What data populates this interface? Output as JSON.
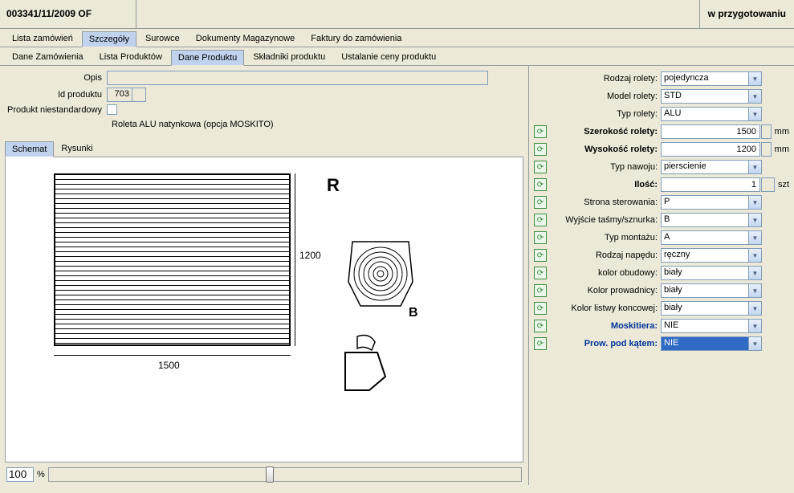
{
  "header": {
    "order_number": "003341/11/2009 OF",
    "status": "w przygotowaniu"
  },
  "tabs": {
    "items": [
      {
        "label": "Lista zamówień"
      },
      {
        "label": "Szczegóły"
      },
      {
        "label": "Surowce"
      },
      {
        "label": "Dokumenty Magazynowe"
      },
      {
        "label": "Faktury do zamówienia"
      }
    ],
    "active": 1
  },
  "subtabs": {
    "items": [
      {
        "label": "Dane Zamówienia"
      },
      {
        "label": "Lista Produktów"
      },
      {
        "label": "Dane Produktu"
      },
      {
        "label": "Składniki produktu"
      },
      {
        "label": "Ustalanie ceny produktu"
      }
    ],
    "active": 2
  },
  "left_form": {
    "opis_label": "Opis",
    "opis_value": "",
    "id_label": "Id produktu",
    "id_value": "703",
    "nonstd_label": "Produkt niestandardowy",
    "description": "Roleta ALU natynkowa (opcja MOSKITO)"
  },
  "schema_tabs": {
    "items": [
      {
        "label": "Schemat"
      },
      {
        "label": "Rysunki"
      }
    ],
    "active": 0
  },
  "schematic": {
    "width_label": "1500",
    "height_label": "1200",
    "R": "R",
    "B": "B"
  },
  "zoom": {
    "value": "100",
    "percent": "%"
  },
  "props": [
    {
      "label": "Rodzaj rolety:",
      "value": "pojedyncza",
      "type": "combo",
      "refresh": false,
      "bold": false,
      "blue": false,
      "hl": false
    },
    {
      "label": "Model rolety:",
      "value": "STD",
      "type": "combo",
      "refresh": false,
      "bold": false,
      "blue": false,
      "hl": false
    },
    {
      "label": "Typ rolety:",
      "value": "ALU",
      "type": "combo",
      "refresh": false,
      "bold": false,
      "blue": false,
      "hl": false
    },
    {
      "label": "Szerokość rolety:",
      "value": "1500",
      "type": "num",
      "unit": "mm",
      "refresh": true,
      "bold": true,
      "blue": false,
      "hl": false
    },
    {
      "label": "Wysokość rolety:",
      "value": "1200",
      "type": "num",
      "unit": "mm",
      "refresh": true,
      "bold": true,
      "blue": false,
      "hl": false
    },
    {
      "label": "Typ nawoju:",
      "value": "pierscienie",
      "type": "combo",
      "refresh": true,
      "bold": false,
      "blue": false,
      "hl": false
    },
    {
      "label": "Ilość:",
      "value": "1",
      "type": "num",
      "unit": "szt",
      "refresh": true,
      "bold": true,
      "blue": false,
      "hl": false
    },
    {
      "label": "Strona sterowania:",
      "value": "P",
      "type": "combo",
      "refresh": true,
      "bold": false,
      "blue": false,
      "hl": false
    },
    {
      "label": "Wyjście taśmy/sznurka:",
      "value": "B",
      "type": "combo",
      "refresh": true,
      "bold": false,
      "blue": false,
      "hl": false
    },
    {
      "label": "Typ montażu:",
      "value": "A",
      "type": "combo",
      "refresh": true,
      "bold": false,
      "blue": false,
      "hl": false
    },
    {
      "label": "Rodzaj napędu:",
      "value": "ręczny",
      "type": "combo",
      "refresh": true,
      "bold": false,
      "blue": false,
      "hl": false
    },
    {
      "label": "kolor obudowy:",
      "value": "biały",
      "type": "combo",
      "refresh": true,
      "bold": false,
      "blue": false,
      "hl": false
    },
    {
      "label": "Kolor prowadnicy:",
      "value": "biały",
      "type": "combo",
      "refresh": true,
      "bold": false,
      "blue": false,
      "hl": false
    },
    {
      "label": "Kolor listwy koncowej:",
      "value": "biały",
      "type": "combo",
      "refresh": true,
      "bold": false,
      "blue": false,
      "hl": false
    },
    {
      "label": "Moskitiera:",
      "value": "NIE",
      "type": "combo",
      "refresh": true,
      "bold": false,
      "blue": true,
      "hl": false
    },
    {
      "label": "Prow. pod kątem:",
      "value": "NIE",
      "type": "combo",
      "refresh": true,
      "bold": false,
      "blue": true,
      "hl": true
    }
  ]
}
